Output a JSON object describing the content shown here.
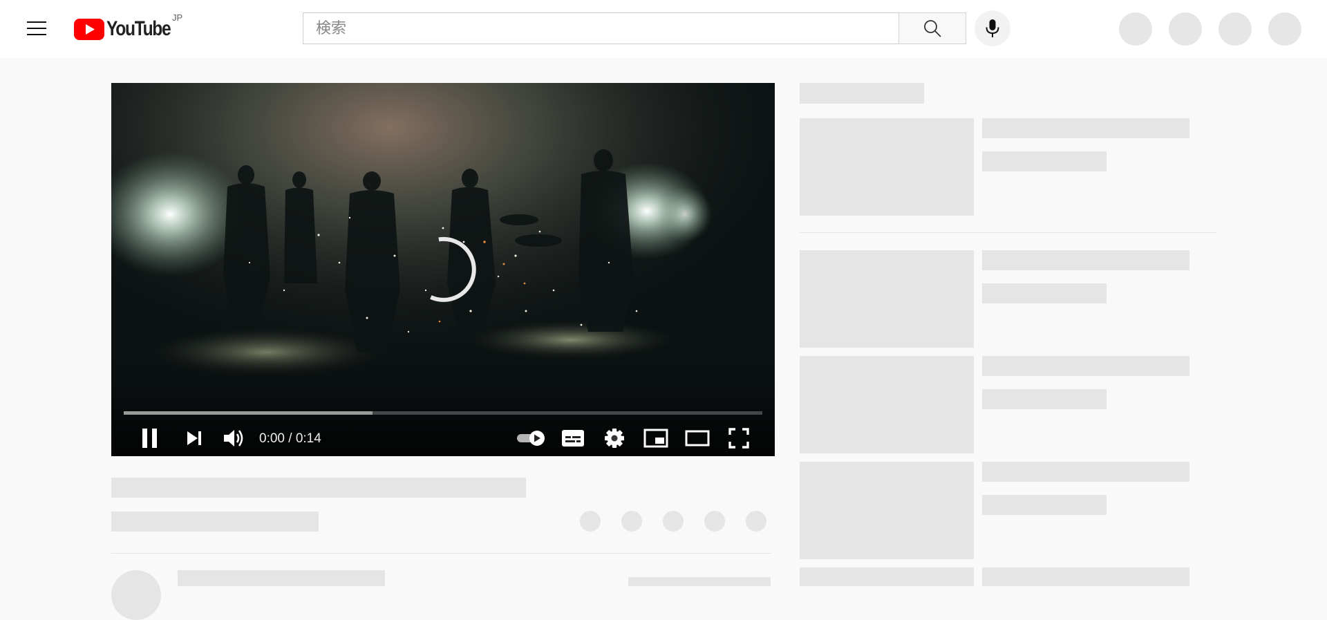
{
  "header": {
    "logo_text": "YouTube",
    "country_code": "JP",
    "search": {
      "placeholder": "検索",
      "value": ""
    },
    "icons": [
      "menu-icon",
      "youtube-logo-icon",
      "search-icon",
      "microphone-icon"
    ]
  },
  "player": {
    "time_current": "0:00",
    "time_separator": "/",
    "time_total": "0:14",
    "buffered_fraction": 0.39,
    "played_fraction": 0.0,
    "loading": true,
    "autoplay_on": true,
    "controls": [
      "pause-icon",
      "next-icon",
      "volume-icon",
      "autoplay-toggle-icon",
      "subtitles-icon",
      "settings-icon",
      "miniplayer-icon",
      "theater-mode-icon",
      "fullscreen-icon"
    ]
  },
  "colors": {
    "brand_red": "#ff0000",
    "page_bg": "#f9f9f9",
    "skeleton": "#e5e5e5",
    "player_bg": "#0b0f10"
  }
}
